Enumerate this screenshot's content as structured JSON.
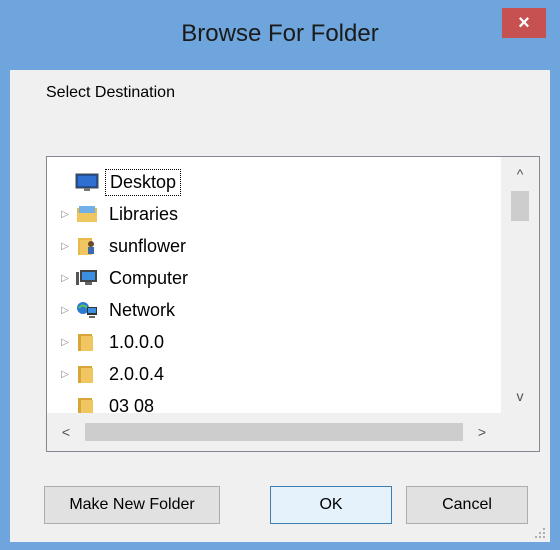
{
  "window": {
    "title": "Browse For Folder",
    "close_label": "×"
  },
  "prompt": "Select Destination",
  "tree": {
    "items": [
      {
        "label": "Desktop",
        "icon": "desktop-icon",
        "expander": ""
      },
      {
        "label": "Libraries",
        "icon": "libraries-icon",
        "expander": "▷"
      },
      {
        "label": "sunflower",
        "icon": "user-folder-icon",
        "expander": "▷"
      },
      {
        "label": "Computer",
        "icon": "computer-icon",
        "expander": "▷"
      },
      {
        "label": "Network",
        "icon": "network-icon",
        "expander": "▷"
      },
      {
        "label": "1.0.0.0",
        "icon": "folder-icon",
        "expander": "▷"
      },
      {
        "label": "2.0.0.4",
        "icon": "folder-icon",
        "expander": "▷"
      },
      {
        "label": "03 08",
        "icon": "folder-icon",
        "expander": ""
      }
    ],
    "selected_index": 0
  },
  "scroll": {
    "up_arrow": "^",
    "down_arrow": "v",
    "left_arrow": "<",
    "right_arrow": ">"
  },
  "buttons": {
    "make_new_folder": "Make New Folder",
    "ok": "OK",
    "cancel": "Cancel"
  },
  "colors": {
    "frame": "#6ea5dc",
    "close": "#c75050",
    "client": "#f0f0f0",
    "folder": "#e8b84a"
  }
}
